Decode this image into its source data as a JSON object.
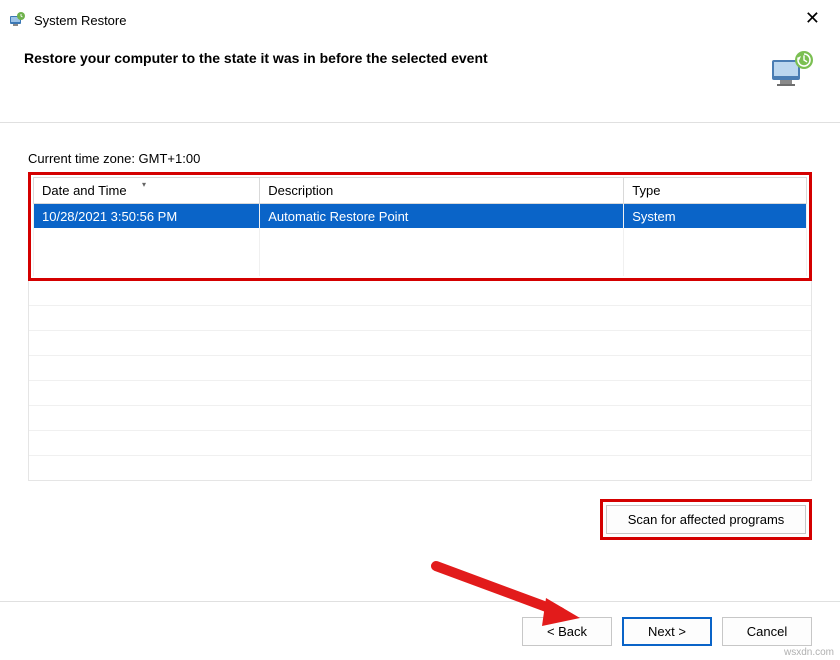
{
  "window": {
    "title": "System Restore"
  },
  "header": {
    "heading": "Restore your computer to the state it was in before the selected event"
  },
  "timezone_label": "Current time zone: GMT+1:00",
  "table": {
    "columns": {
      "date": "Date and Time",
      "description": "Description",
      "type": "Type"
    },
    "rows": [
      {
        "date": "10/28/2021 3:50:56 PM",
        "description": "Automatic Restore Point",
        "type": "System"
      }
    ]
  },
  "buttons": {
    "scan": "Scan for affected programs",
    "back": "< Back",
    "next": "Next >",
    "cancel": "Cancel"
  },
  "watermark": "wsxdn.com"
}
